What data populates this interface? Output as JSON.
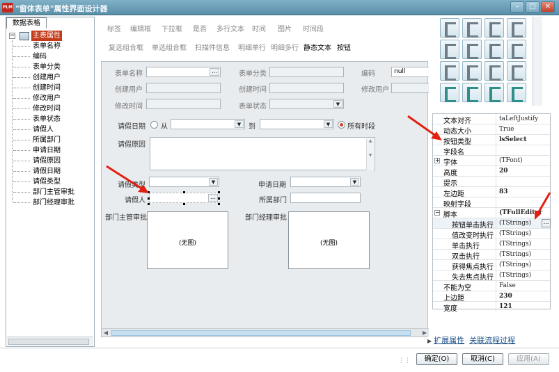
{
  "window": {
    "app_icon": "PLM",
    "title": "\"窗体表单\"属性界面设计器",
    "controls": [
      "minimize-icon",
      "maximize-icon",
      "close-icon"
    ]
  },
  "left_panel": {
    "tab": "数据表格",
    "root": "主表属性",
    "items": [
      "表单名称",
      "编码",
      "表单分类",
      "创建用户",
      "创建时间",
      "修改用户",
      "修改时间",
      "表单状态",
      "请假人",
      "所属部门",
      "申请日期",
      "请假原因",
      "请假日期",
      "请假类型",
      "部门主管审批",
      "部门经理审批"
    ]
  },
  "palette": {
    "row1": [
      "标签",
      "编辑框",
      "下拉框",
      "是否",
      "多行文本",
      "时间",
      "图片",
      "时间段"
    ],
    "row2": [
      "复选组合框",
      "单选组合框",
      "扫描件信息",
      "明细单行",
      "明细多行",
      "静态文本",
      "按钮"
    ]
  },
  "form": {
    "form_name_label": "表单名称",
    "form_category_label": "表单分类",
    "code_label": "编码",
    "code_value": "null",
    "creator_label": "创建用户",
    "created_time_label": "创建时间",
    "modifier_label": "修改用户",
    "modified_time_label": "修改时间",
    "status_label": "表单状态",
    "leave_date_label": "请假日期",
    "from_label": "从",
    "to_label": "到",
    "all_periods_label": "所有时段",
    "reason_label": "请假原因",
    "leave_type_label": "请假类型",
    "apply_date_label": "申请日期",
    "applicant_label": "请假人",
    "department_label": "所属部门",
    "supervisor_label": "部门主管审批",
    "manager_label": "部门经理审批",
    "no_image": "(无图)"
  },
  "properties": [
    {
      "name": "文本对齐",
      "value": "taLeftJustify"
    },
    {
      "name": "动态大小",
      "value": "True"
    },
    {
      "name": "按钮类型",
      "value": "lsSelect"
    },
    {
      "name": "字段名",
      "value": ""
    },
    {
      "name": "字体",
      "value": "(TFont)"
    },
    {
      "name": "高度",
      "value": "20"
    },
    {
      "name": "提示",
      "value": ""
    },
    {
      "name": "左边距",
      "value": "83"
    },
    {
      "name": "映射字段",
      "value": ""
    },
    {
      "name": "脚本",
      "value": "(TFullEditor"
    },
    {
      "name": "按钮单击执行",
      "value": "(TStrings)"
    },
    {
      "name": "值改变时执行",
      "value": "(TStrings)"
    },
    {
      "name": "单击执行",
      "value": "(TStrings)"
    },
    {
      "name": "双击执行",
      "value": "(TStrings)"
    },
    {
      "name": "获得焦点执行",
      "value": "(TStrings)"
    },
    {
      "name": "失去焦点执行",
      "value": "(TStrings)"
    },
    {
      "name": "不能为空",
      "value": "False"
    },
    {
      "name": "上边距",
      "value": "230"
    },
    {
      "name": "宽度",
      "value": "121"
    }
  ],
  "links": {
    "extended": "扩展属性",
    "workflow": "关联流程过程"
  },
  "buttons": {
    "ok": "确定(O)",
    "cancel": "取消(C)",
    "apply": "应用(A)"
  },
  "colors": {
    "selection_red": "#c43a1a",
    "annotation_red": "#e02010",
    "link_blue": "#1a4f88"
  }
}
